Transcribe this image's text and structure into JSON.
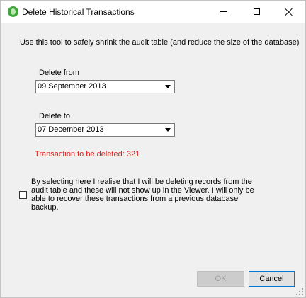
{
  "window": {
    "title": "Delete Historical Transactions",
    "controls": {
      "minimize": "minimize-icon",
      "maximize": "maximize-icon",
      "close": "close-icon"
    }
  },
  "intro_text": "Use this tool to safely shrink the audit table (and reduce the size of the database)",
  "delete_from": {
    "label": "Delete from",
    "value": "09 September 2013"
  },
  "delete_to": {
    "label": "Delete to",
    "value": "07 December 2013"
  },
  "transactions_message": "Transaction to be deleted: 321",
  "confirmation": {
    "checked": false,
    "text": "By selecting here I realise that I will be deleting records from the audit table and these will not show up in the Viewer. I will only be able to recover these transactions from a previous database backup."
  },
  "buttons": {
    "ok": "OK",
    "cancel": "Cancel"
  },
  "colors": {
    "warning": "#e02020",
    "focus_border": "#0078d7",
    "app_icon": "#3ea63a"
  }
}
